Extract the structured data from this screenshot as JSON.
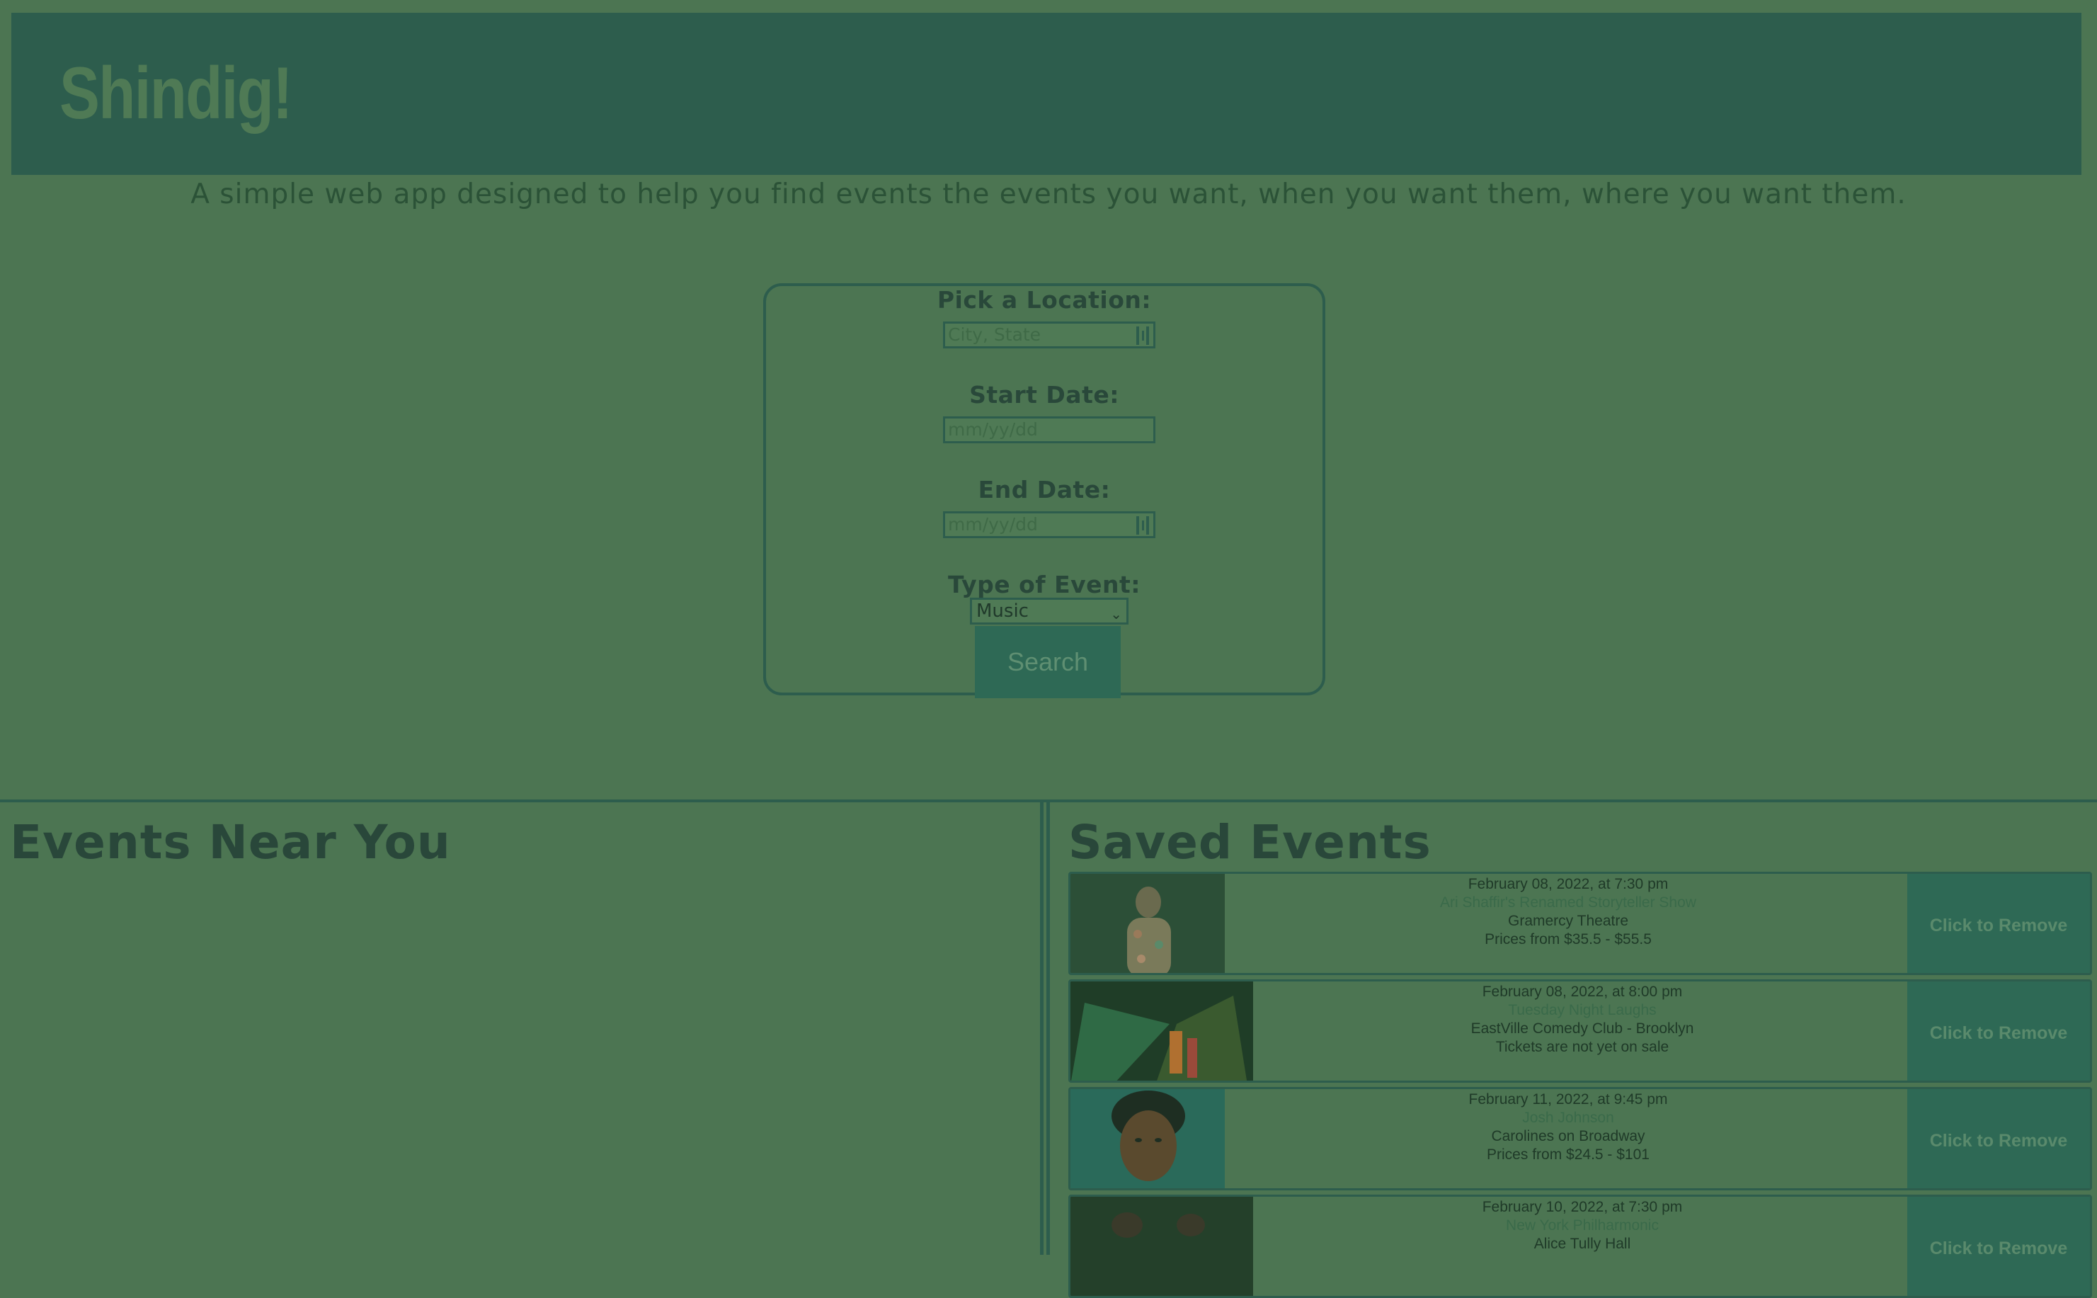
{
  "header": {
    "brand": "Shindig!"
  },
  "tagline": "A simple web app designed to help you find events the events you want, when you want them, where you want them.",
  "search_form": {
    "location_label": "Pick a Location:",
    "location_placeholder": "City, State",
    "start_label": "Start Date:",
    "start_placeholder": "mm/yy/dd",
    "end_label": "End Date:",
    "end_placeholder": "mm/yy/dd",
    "type_label": "Type of Event:",
    "type_selected": "Music",
    "search_button": "Search"
  },
  "events_near_you": {
    "title": "Events Near You"
  },
  "saved_events": {
    "title": "Saved Events",
    "items": [
      {
        "date": "February 08, 2022, at 7:30 pm",
        "name": "Ari Shaffir's Renamed Storyteller Show",
        "venue": "Gramercy Theatre",
        "price": "Prices from $35.5 - $55.5",
        "remove_label": "Click to Remove"
      },
      {
        "date": "February 08, 2022, at 8:00 pm",
        "name": "Tuesday Night Laughs",
        "venue": "EastVille Comedy Club - Brooklyn",
        "price": "Tickets are not yet on sale",
        "remove_label": "Click to Remove"
      },
      {
        "date": "February 11, 2022, at 9:45 pm",
        "name": "Josh Johnson",
        "venue": "Carolines on Broadway",
        "price": "Prices from $24.5 - $101",
        "remove_label": "Click to Remove"
      },
      {
        "date": "February 10, 2022, at 7:30 pm",
        "name": "New York Philharmonic",
        "venue": "Alice Tully Hall",
        "price": "",
        "remove_label": "Click to Remove"
      }
    ]
  },
  "colors": {
    "background": "#4c7552",
    "header": "#2d5d4d",
    "button": "#2e6955",
    "text_dark": "#25452e"
  }
}
